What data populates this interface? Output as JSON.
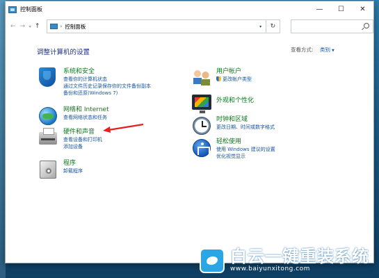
{
  "window": {
    "title": "控制面板",
    "controls": {
      "minimize": "—",
      "maximize": "☐",
      "close": "✕"
    }
  },
  "nav": {
    "back": "←",
    "forward": "→",
    "dropdown": "▾",
    "up": "↑",
    "address_separator": "›",
    "address_path": "控制面板",
    "address_dropdown": "▾",
    "refresh": "↻",
    "search_placeholder": ""
  },
  "main": {
    "heading": "调整计算机的设置",
    "view_by_label": "查看方式:",
    "view_by_value": "类别",
    "view_by_caret": "▼",
    "categories_left": [
      {
        "title": "系统和安全",
        "icon": "shield-icon",
        "links": [
          "查看你的计算机状态",
          "通过文件历史记录保存你的文件备份副本",
          "备份和还原(Windows 7)"
        ]
      },
      {
        "title": "网络和 Internet",
        "icon": "globe-icon",
        "links": [
          "查看网络状态和任务"
        ]
      },
      {
        "title": "硬件和声音",
        "icon": "printer-icon",
        "links": [
          "查看设备和打印机",
          "添加设备"
        ]
      },
      {
        "title": "程序",
        "icon": "programs-icon",
        "links": [
          "卸载程序"
        ]
      }
    ],
    "categories_right": [
      {
        "title": "用户帐户",
        "icon": "users-icon",
        "links": [
          "更改帐户类型"
        ]
      },
      {
        "title": "外观和个性化",
        "icon": "appearance-icon",
        "links": []
      },
      {
        "title": "时钟和区域",
        "icon": "clock-icon",
        "links": [
          "更改日期、时间或数字格式"
        ]
      },
      {
        "title": "轻松使用",
        "icon": "accessibility-icon",
        "links": [
          "使用 Windows 建议的设置",
          "优化视觉显示"
        ]
      }
    ]
  },
  "annotation": {
    "color": "#e32020"
  },
  "watermark": {
    "title": "白云一键重装系统",
    "url": "www.baiyunxitong.com",
    "logo": "bird-logo-icon"
  },
  "colors": {
    "category_title": "#0a7a1e",
    "link": "#1553a6",
    "heading": "#1e3287",
    "desktop": "#1e5f86"
  }
}
